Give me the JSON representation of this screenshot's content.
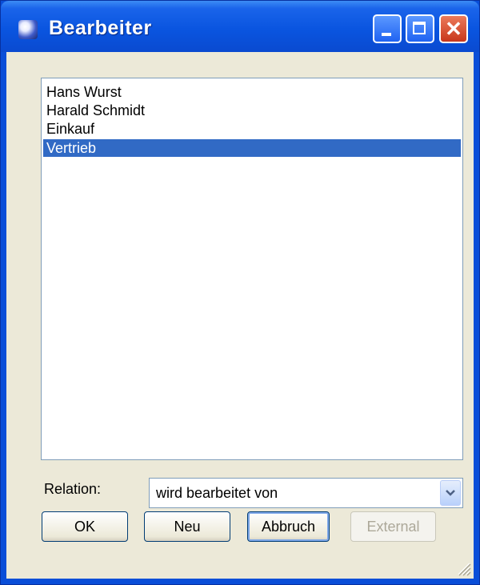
{
  "window": {
    "title": "Bearbeiter",
    "controls": {
      "minimize": "minimize-icon",
      "maximize": "maximize-icon",
      "close": "close-icon"
    }
  },
  "list": {
    "items": [
      "Hans Wurst",
      "Harald Schmidt",
      "Einkauf",
      "Vertrieb"
    ],
    "selected": "Vertrieb"
  },
  "relation": {
    "label": "Relation:",
    "value": "wird bearbeitet von"
  },
  "buttons": {
    "ok": "OK",
    "neu": "Neu",
    "abbruch": "Abbruch",
    "external": "External"
  },
  "colors": {
    "titlebar": "#0a55e0",
    "selection": "#316ac5",
    "face": "#ece9d8"
  }
}
